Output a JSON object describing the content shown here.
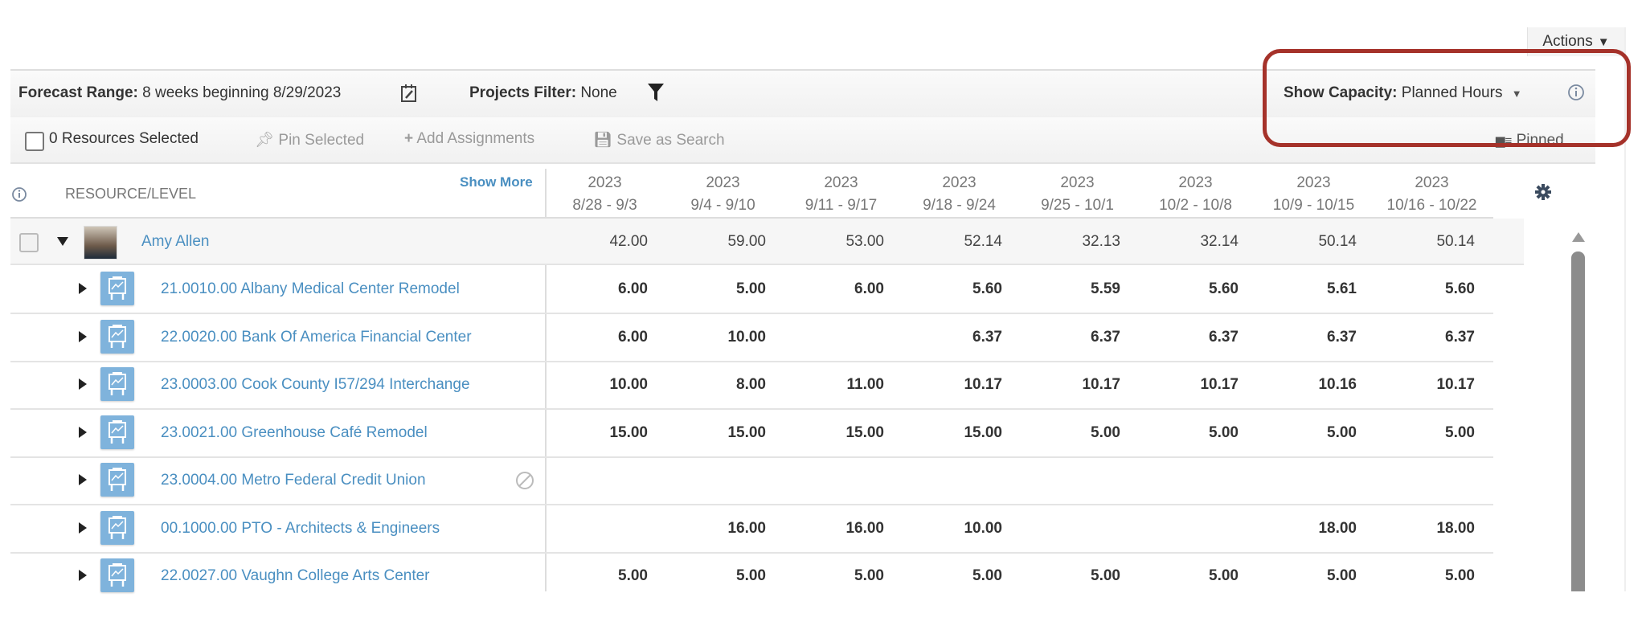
{
  "actions_label": "Actions",
  "toolbar": {
    "forecast_label": "Forecast Range:",
    "forecast_value": "8 weeks beginning 8/29/2023",
    "projects_filter_label": "Projects Filter:",
    "projects_filter_value": "None",
    "show_capacity_label": "Show Capacity:",
    "show_capacity_value": "Planned Hours",
    "resources_selected": "0 Resources Selected",
    "pin_selected": "Pin Selected",
    "add_assignments": "Add Assignments",
    "save_as_search": "Save as Search",
    "pinned": "Pinned"
  },
  "grid": {
    "resource_header": "RESOURCE/LEVEL",
    "show_more": "Show More",
    "columns": [
      {
        "year": "2023",
        "range": "8/28 - 9/3"
      },
      {
        "year": "2023",
        "range": "9/4 - 9/10"
      },
      {
        "year": "2023",
        "range": "9/11 - 9/17"
      },
      {
        "year": "2023",
        "range": "9/18 - 9/24"
      },
      {
        "year": "2023",
        "range": "9/25 - 10/1"
      },
      {
        "year": "2023",
        "range": "10/2 - 10/8"
      },
      {
        "year": "2023",
        "range": "10/9 - 10/15"
      },
      {
        "year": "2023",
        "range": "10/16 - 10/22"
      }
    ],
    "resource": {
      "name": "Amy Allen",
      "values": [
        "42.00",
        "59.00",
        "53.00",
        "52.14",
        "32.13",
        "32.14",
        "50.14",
        "50.14"
      ]
    },
    "projects": [
      {
        "name": "21.0010.00 Albany Medical Center Remodel",
        "blocked": false,
        "values": [
          "6.00",
          "5.00",
          "6.00",
          "5.60",
          "5.59",
          "5.60",
          "5.61",
          "5.60"
        ]
      },
      {
        "name": "22.0020.00 Bank Of America Financial Center",
        "blocked": false,
        "values": [
          "6.00",
          "10.00",
          "",
          "6.37",
          "6.37",
          "6.37",
          "6.37",
          "6.37"
        ]
      },
      {
        "name": "23.0003.00 Cook County I57/294 Interchange",
        "blocked": false,
        "values": [
          "10.00",
          "8.00",
          "11.00",
          "10.17",
          "10.17",
          "10.17",
          "10.16",
          "10.17"
        ]
      },
      {
        "name": "23.0021.00 Greenhouse Café Remodel",
        "blocked": false,
        "values": [
          "15.00",
          "15.00",
          "15.00",
          "15.00",
          "5.00",
          "5.00",
          "5.00",
          "5.00"
        ]
      },
      {
        "name": "23.0004.00 Metro Federal Credit Union",
        "blocked": true,
        "values": [
          "",
          "",
          "",
          "",
          "",
          "",
          "",
          ""
        ]
      },
      {
        "name": "00.1000.00 PTO - Architects & Engineers",
        "blocked": false,
        "values": [
          "",
          "16.00",
          "16.00",
          "10.00",
          "",
          "",
          "18.00",
          "18.00"
        ]
      },
      {
        "name": "22.0027.00 Vaughn College Arts Center",
        "blocked": false,
        "values": [
          "5.00",
          "5.00",
          "5.00",
          "5.00",
          "5.00",
          "5.00",
          "5.00",
          "5.00"
        ]
      }
    ]
  },
  "colors": {
    "link": "#4a8fc1",
    "highlight_box": "#a5322a",
    "project_icon": "#7fb3dc"
  }
}
